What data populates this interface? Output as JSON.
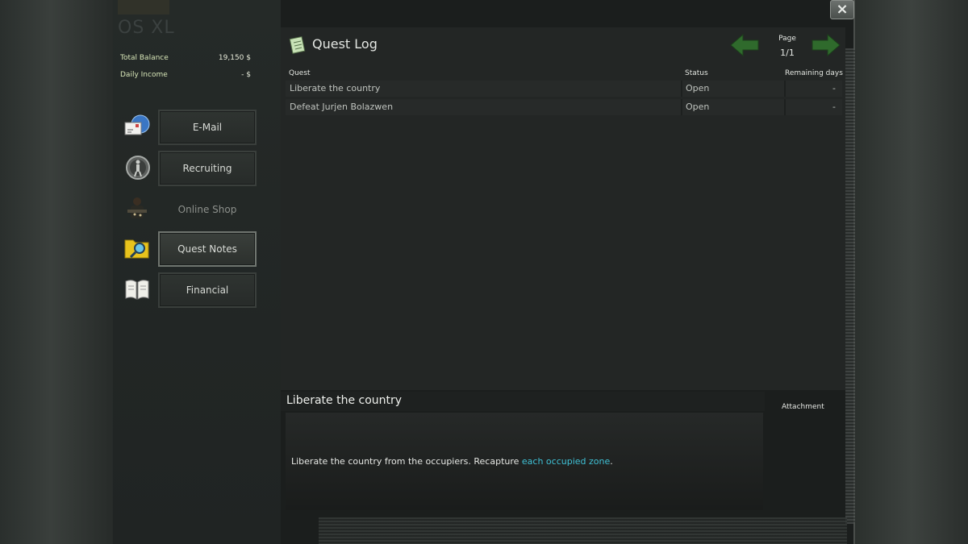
{
  "app": {
    "logo": "OS XL",
    "close_label": "×"
  },
  "finance": {
    "total_balance_label": "Total Balance",
    "total_balance_value": "19,150 $",
    "daily_income_label": "Daily Income",
    "daily_income_value": "- $"
  },
  "nav": {
    "items": [
      {
        "label": "E-Mail",
        "icon": "email-icon"
      },
      {
        "label": "Recruiting",
        "icon": "recruit-icon"
      },
      {
        "label": "Online Shop",
        "icon": "soldier-icon"
      },
      {
        "label": "Quest Notes",
        "icon": "folder-search-icon"
      },
      {
        "label": "Financial",
        "icon": "book-icon"
      }
    ],
    "active": "Quest Notes"
  },
  "quest_log": {
    "title": "Quest Log",
    "page_label": "Page",
    "page_value": "1/1",
    "columns": {
      "quest": "Quest",
      "status": "Status",
      "remaining": "Remaining days"
    },
    "rows": [
      {
        "quest": "Liberate the country",
        "status": "Open",
        "remaining": "-"
      },
      {
        "quest": "Defeat Jurjen Bolazwen",
        "status": "Open",
        "remaining": "-"
      }
    ]
  },
  "detail": {
    "title": "Liberate the country",
    "text_before": "Liberate the country from the occupiers. Recapture ",
    "text_highlight": "each occupied zone",
    "text_after": ".",
    "attachment_label": "Attachment"
  },
  "colors": {
    "accent_arrow": "#2f6a2c",
    "highlight_text": "#3fc2d6",
    "finance_label": "#d7e6b8"
  }
}
